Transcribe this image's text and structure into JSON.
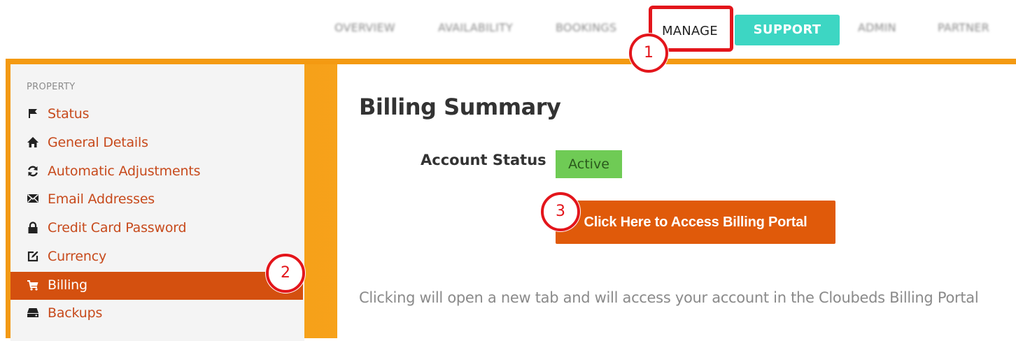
{
  "topnav": {
    "items": [
      "OVERVIEW",
      "AVAILABILITY",
      "BOOKINGS",
      "MANAGE",
      "SUPPORT",
      "ADMIN",
      "PARTNER"
    ],
    "active_item": "MANAGE"
  },
  "sidebar": {
    "heading": "PROPERTY",
    "items": [
      {
        "label": "Status",
        "icon": "flag-icon"
      },
      {
        "label": "General Details",
        "icon": "home-icon"
      },
      {
        "label": "Automatic Adjustments",
        "icon": "refresh-icon"
      },
      {
        "label": "Email Addresses",
        "icon": "envelope-icon"
      },
      {
        "label": "Credit Card Password",
        "icon": "lock-icon"
      },
      {
        "label": "Currency",
        "icon": "edit-icon"
      },
      {
        "label": "Billing",
        "icon": "cart-icon",
        "active": true
      },
      {
        "label": "Backups",
        "icon": "drive-icon"
      }
    ]
  },
  "main": {
    "title": "Billing Summary",
    "account_status_label": "Account Status",
    "account_status_value": "Active",
    "portal_button_label": "Click Here to Access Billing Portal",
    "help_text": "Clicking will open a new tab and will access your account in the Cloubeds Billing Portal"
  },
  "callouts": [
    "1",
    "2",
    "3"
  ],
  "colors": {
    "accent_orange": "#e05a0a",
    "sidebar_active": "#d4500f",
    "link_color": "#c74a1c",
    "support_teal": "#3dd6c3",
    "status_green": "#6fcb55",
    "callout_red": "#e3151b"
  }
}
